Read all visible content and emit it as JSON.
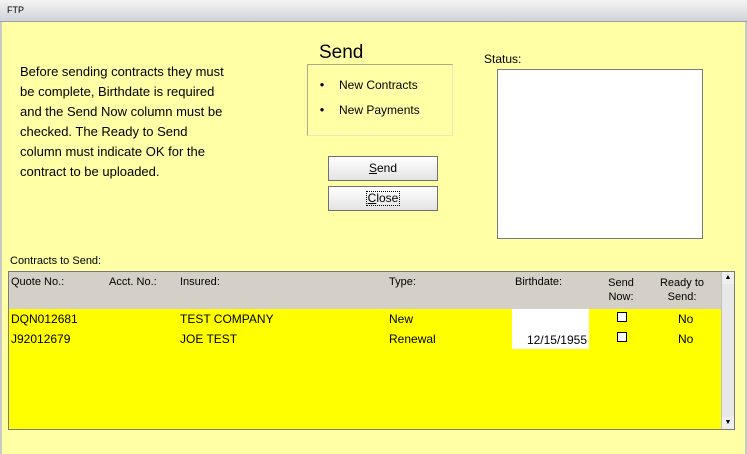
{
  "window": {
    "title": "FTP"
  },
  "instructions": {
    "lines": [
      "Before sending contracts they must",
      "be complete,  Birthdate is required",
      "and the Send Now column must be",
      "checked.  The Ready to Send",
      "column must indicate OK for the",
      "contract to be uploaded."
    ]
  },
  "send_group": {
    "title": "Send",
    "options": [
      "New Contracts",
      "New Payments"
    ],
    "radio_glyph": "●"
  },
  "buttons": {
    "send_prefix": "",
    "send_underline": "S",
    "send_rest": "end",
    "close_prefix": "",
    "close_underline": "C",
    "close_rest": "lose"
  },
  "status": {
    "label": "Status:",
    "value": ""
  },
  "contracts": {
    "label": "Contracts to Send:",
    "columns": {
      "quote": "Quote No.:",
      "acct": "Acct. No.:",
      "insured": "Insured:",
      "type": "Type:",
      "birthdate": "Birthdate:",
      "send_now_1": "Send",
      "send_now_2": "Now:",
      "ready_1": "Ready to",
      "ready_2": "Send:"
    },
    "rows": [
      {
        "quote": "DQN012681",
        "acct": "",
        "insured": "TEST COMPANY",
        "type": "New",
        "birthdate": "",
        "send_now": false,
        "ready": "No"
      },
      {
        "quote": "J92012679",
        "acct": "",
        "insured": "JOE TEST",
        "type": "Renewal",
        "birthdate": "12/15/1955",
        "send_now": false,
        "ready": "No"
      }
    ]
  },
  "scrollbar": {
    "up": "▲",
    "down": "▼"
  },
  "colors": {
    "form_bg": "#ffffa6",
    "grid_bg": "#ffff00",
    "header_bg": "#d4d0c8"
  }
}
